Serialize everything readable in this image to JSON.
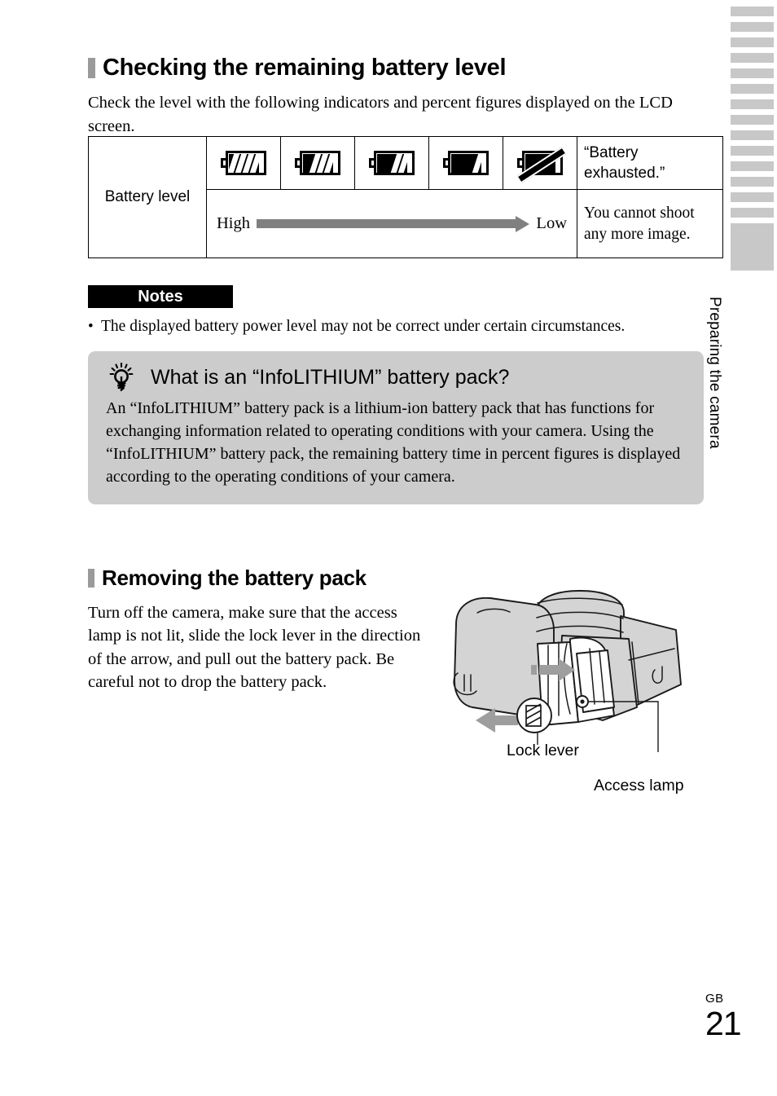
{
  "page": {
    "folio_prefix": "GB",
    "folio_number": "21",
    "side_tab_title": "Preparing the camera",
    "thumb_index": {
      "tick_count": 15,
      "active_index": 15
    },
    "accent_gray": "#cccccc",
    "bullet_gray": "#9a9a9a",
    "arrow_gray": "#808080"
  },
  "section_battery": {
    "heading": "Checking the remaining battery level",
    "intro": "Check the level with the following indicators and percent figures displayed on the LCD screen.",
    "table": {
      "row_label": "Battery level",
      "icons": [
        {
          "name": "battery-full-icon",
          "bars": 4,
          "slashed": false
        },
        {
          "name": "battery-three-quarter-icon",
          "bars": 3,
          "slashed": false
        },
        {
          "name": "battery-half-icon",
          "bars": 2,
          "slashed": false
        },
        {
          "name": "battery-low-icon",
          "bars": 1,
          "slashed": false
        },
        {
          "name": "battery-empty-slashed-icon",
          "bars": 0,
          "slashed": true
        }
      ],
      "exhausted_label": "“Battery exhausted.”",
      "range_high": "High",
      "range_low": "Low",
      "cannot_shoot_text": "You cannot shoot any more image."
    }
  },
  "notes": {
    "banner_label": "Notes",
    "bullet_char": "•",
    "items": [
      "The displayed battery power level may not be correct under certain circumstances."
    ]
  },
  "callout": {
    "icon_name": "lightbulb-tip-icon",
    "heading": "What is an “InfoLITHIUM” battery pack?",
    "body": "An “InfoLITHIUM” battery pack is a lithium-ion battery pack that has functions for exchanging information related to operating conditions with your camera. Using the “InfoLITHIUM” battery pack, the remaining battery time in percent figures is displayed according to the operating conditions of your camera."
  },
  "section_removing": {
    "heading": "Removing the battery pack",
    "body": "Turn off the camera, make sure that the access lamp is not lit, slide the lock lever in the direction of the arrow, and pull out the battery pack. Be careful not to drop the battery pack.",
    "figure": {
      "name": "camera-battery-compartment-illustration",
      "labels": {
        "lock_lever": "Lock lever",
        "access_lamp": "Access lamp"
      }
    }
  }
}
